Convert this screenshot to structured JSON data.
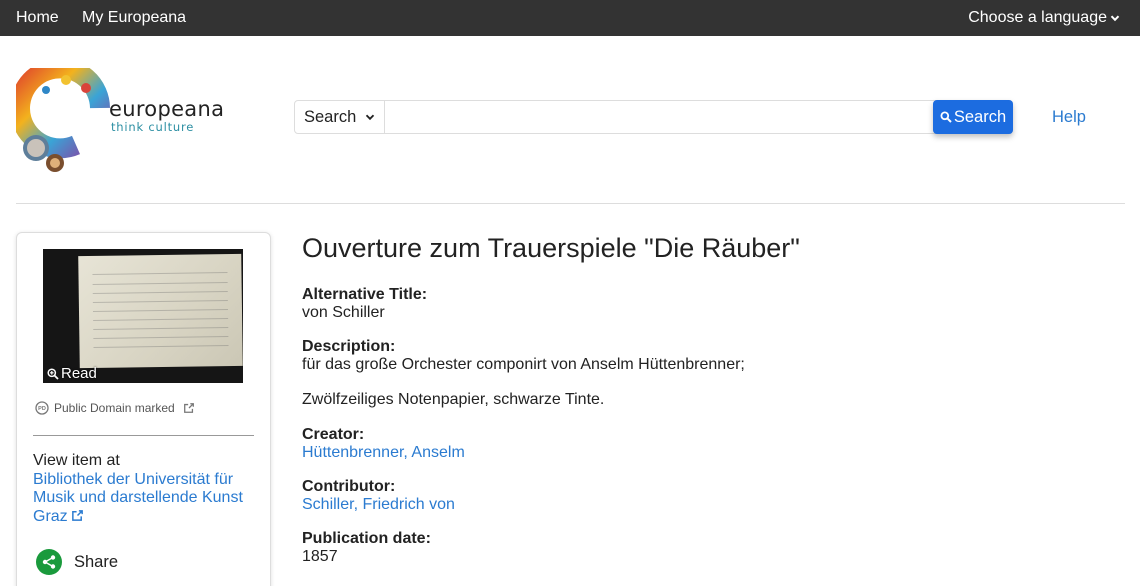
{
  "topbar": {
    "home": "Home",
    "my_europeana": "My Europeana",
    "language": "Choose a language"
  },
  "logo": {
    "brand": "europeana",
    "tagline": "think culture"
  },
  "search": {
    "scope": "Search",
    "placeholder": "",
    "button": "Search",
    "help": "Help",
    "accent_color": "#1c6ce0"
  },
  "item_panel": {
    "read_label": "Read",
    "rights": "Public Domain marked",
    "view_at_label": "View item at",
    "provider": "Bibliothek der Universität für Musik und darstellende Kunst Graz",
    "share": "Share"
  },
  "record": {
    "title": "Ouverture zum Trauerspiele \"Die Räuber\"",
    "alternative_title": {
      "label": "Alternative Title:",
      "value": "von Schiller"
    },
    "description": {
      "label": "Description:",
      "value": "für das große Orchester componirt von Anselm Hüttenbrenner;",
      "value2": "Zwölfzeiliges Notenpapier, schwarze Tinte."
    },
    "creator": {
      "label": "Creator:",
      "value": "Hüttenbrenner, Anselm"
    },
    "contributor": {
      "label": "Contributor:",
      "value": "Schiller, Friedrich von"
    },
    "publication_date": {
      "label": "Publication date:",
      "value": "1857"
    }
  }
}
